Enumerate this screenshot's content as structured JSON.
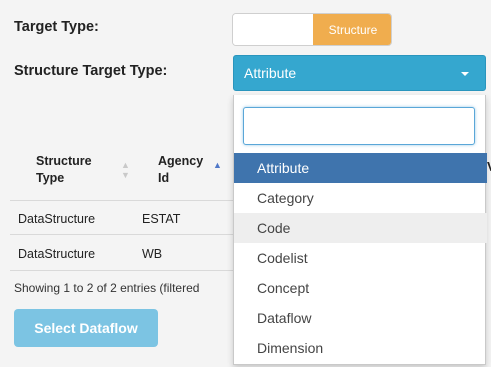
{
  "form": {
    "target_type_label": "Target Type:",
    "target_type_toggle_on": "Structure",
    "structure_target_type_label": "Structure Target Type:",
    "structure_target_type_selected": "Attribute"
  },
  "table": {
    "headers": [
      "Structure Type",
      "Agency Id"
    ],
    "header_lines": [
      [
        "Structure",
        "Type"
      ],
      [
        "Agency",
        "Id"
      ]
    ],
    "rows": [
      [
        "DataStructure",
        "ESTAT"
      ],
      [
        "DataStructure",
        "WB"
      ]
    ],
    "info": "Showing 1 to 2 of 2 entries (filtered"
  },
  "actions": {
    "select_dataflow": "Select Dataflow"
  },
  "dropdown": {
    "search_value": "",
    "options": [
      "Attribute",
      "Category",
      "Code",
      "Codelist",
      "Concept",
      "Dataflow",
      "Dimension"
    ],
    "selected_index": 0,
    "hover_index": 2
  },
  "colors": {
    "toggle_on": "#f0ad4e",
    "select_bg": "#35a7cf",
    "selected_option": "#3f74ad",
    "button": "#7cc4e3"
  }
}
